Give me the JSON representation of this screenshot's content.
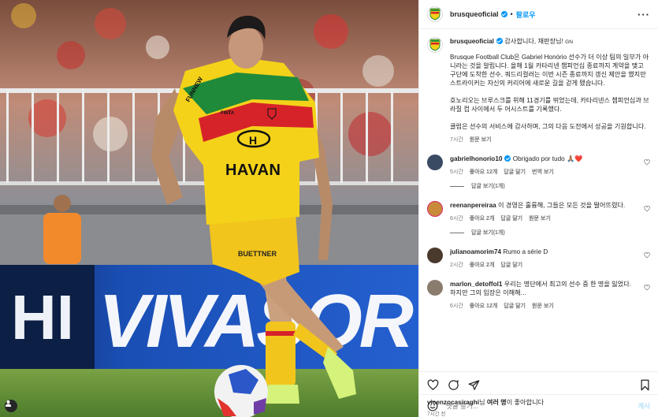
{
  "colors": {
    "accent": "#0095f6",
    "brusque_yellow": "#f4d21a",
    "brusque_red": "#d6232a",
    "brusque_green": "#1f8a3a",
    "banner_blue": "#1a4fb5"
  },
  "photo": {
    "shirt_sponsor": "HAVAN",
    "shirt_sponsor_letter": "H",
    "shirt_brand": "FINTA",
    "sleeve_brand": "FUNNEW",
    "shorts_sponsor": "BUETTNER",
    "banner_text": "VIVASOR",
    "banner_left_text": "HI",
    "tag_icon": "person-icon"
  },
  "header": {
    "username": "brusqueoficial",
    "separator": "•",
    "follow_label": "팔로우",
    "more_icon": "more-horizontal-icon",
    "more_label": "···"
  },
  "caption": {
    "username": "brusqueoficial",
    "headline": "감사합니다, 재판장님!",
    "headline_tag": "GN",
    "body": "Brusque Football Club은 Gabriel Honório 선수가 더 이상 팀의 일부가 아니라는 것을 알립니다. 올해 1월 카타리넨 챔피언십 종료까지 계약을 맺고 구단에 도착한 선수, 쿼드리컬러는 이번 시즌 종료까지 갱신 제안을 했지만 스트라이커는 자신의 커리어에 새로운 길을 걷게 됐습니다.\n\n호노리오는 브루스크를 위해 11경기를 뛰었는데, 카타리넨스 챔피언십과 브라질 컵 사이에서 두 어시스트를 기록했다.\n\n클럽은 선수의 서비스에 감사하며, 그의 다음 도전에서 성공을 기원합니다.",
    "time": "7시간",
    "see_translation": "원문 보기"
  },
  "comments": [
    {
      "username": "gabrielhonorio10",
      "verified": true,
      "text": "Obrigado por tudo 🙏🏽❤️",
      "time": "5시간",
      "likes": "좋아요 12개",
      "reply": "답글 달기",
      "translate": "번역 보기",
      "replies": "답글 보기(1개)"
    },
    {
      "username": "reenanpereiraa",
      "verified": false,
      "text": "이 경영은 훌륭해, 그들은 모든 것을 떨어뜨렸다.",
      "time": "6시간",
      "likes": "좋아요 2개",
      "reply": "답글 달기",
      "translate": "원문 보기",
      "replies": "답글 보기(1개)"
    },
    {
      "username": "julianoamorim74",
      "verified": false,
      "text": "Rumo a série D",
      "time": "2시간",
      "likes": "좋아요 2개",
      "reply": "답글 달기",
      "translate": "",
      "replies": ""
    },
    {
      "username": "marlon_detoffol1",
      "verified": false,
      "text": "우리는 명단에서 최고의 선수 중 한 명을 잃었다. 하지만 그의 입장은 이해해...",
      "time": "6시간",
      "likes": "좋아요 12개",
      "reply": "답글 달기",
      "translate": "원문 보기",
      "replies": ""
    }
  ],
  "footer": {
    "liked_by_user": "vicenzocasiraghi",
    "liked_by_suffix": "님",
    "liked_by_bold": "여러 명",
    "liked_by_tail": "이 좋아합니다",
    "time": "7시간 전",
    "comment_placeholder": "댓글 달기...",
    "post_label": "게시",
    "icons": [
      "heart-icon",
      "comment-icon",
      "share-icon",
      "bookmark-icon",
      "emoji-icon"
    ]
  }
}
